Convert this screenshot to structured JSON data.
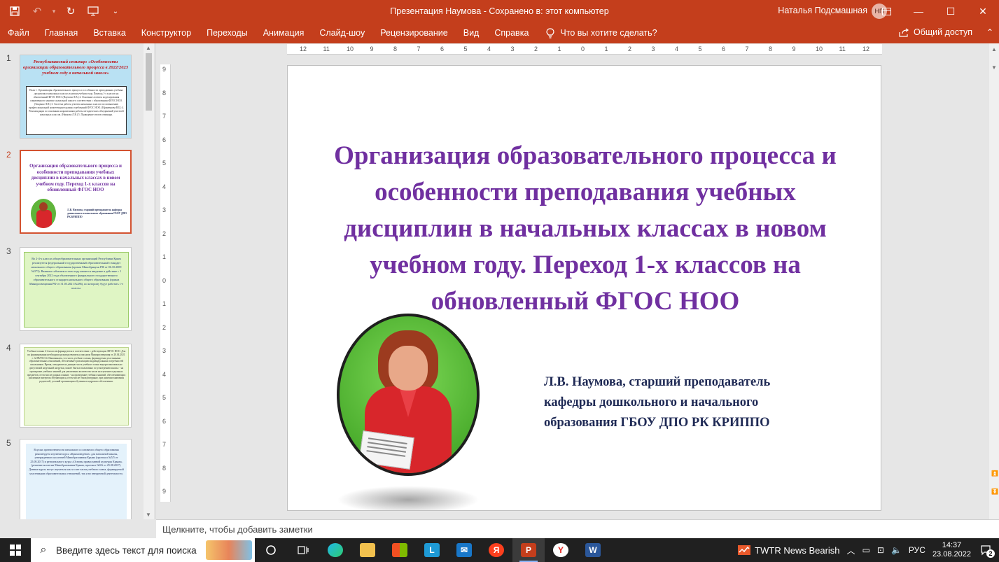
{
  "app": {
    "window_title": "Презентация Наумова  -  Сохранено в: этот компьютер",
    "user_name": "Наталья Подсмашная",
    "user_initials": "НП"
  },
  "ribbon": {
    "tabs": [
      "Файл",
      "Главная",
      "Вставка",
      "Конструктор",
      "Переходы",
      "Анимация",
      "Слайд-шоу",
      "Рецензирование",
      "Вид",
      "Справка"
    ],
    "tell_me": "Что вы хотите сделать?",
    "share": "Общий доступ"
  },
  "thumbnails": {
    "numbers": [
      "1",
      "2",
      "3",
      "4",
      "5"
    ],
    "s1": {
      "title": "Республиканский семинар: «Особенности организации образовательного процесса в 2022/2023 учебном году в начальной школе»",
      "body": "План 1. Организация образовательного процесса и особенности преподавания учебных дисциплин в начальных классах в новом учебном году. Переход 1-х классов на обновленный ФГОС НОО. (Наумова Л.В.) 2. Основные аспекты моделирования современного занятия в начальной школе в соответствии с обновленным ФГОС НОО. (Тищенко Л.Н.) 3. Система работы учителя начальных классов по повышению профессиональной компетенции в рамках требований ФГОС НОО. (Ефименкова В.Б.) 4. Рекомендации по основным направлениям работы методических объединений учителей начальных классов. (Наумова Л.В.) 5. Подведение итогов семинара."
    },
    "s2": {
      "title": "Организация образовательного процесса и особенности преподавания учебных дисциплин в начальных классах в новом учебном году. Переход 1-х классов на обновленный ФГОС НОО",
      "caption": "Л.В. Наумова, старший преподаватель кафедры дошкольного и начального образования ГБОУ ДПО РК КРИППО"
    },
    "s3": {
      "body": "Во 2-4-х классах общеобразовательных организаций Республики Крым реализуется федеральный государственный образовательный стандарт начального общего образования (приказ Минобрнауки РФ от 06.10.2009 №373). Важным событием в этом году является введение в действие с 1 сентября 2022 года обновленного федерального государственного образовательного стандарта начального общего образования (приказ Минпросвещения РФ от 31.05.2021 №286), по которому будут работать 1-е классы."
    },
    "s4": {
      "body": "Учебные планы 2-4 классов формируются в соответствии с действующим ФГОС НОО. Для их формирования необходимо руководствоваться письмом Минпросвещения от 20.04.2021 г. №ТВ/591/14. Напоминаем, что часть учебного плана, формируемая участниками образовательных отношений, обеспечивает реализацию индивидуальных потребностей школьников. Время, отводимое на данную часть учебного плана внутри максимально допустимой недельной нагрузки, может быть использовано по усмотрению школы: - на проведение учебных занятий для увеличения количества часов на изучение отдельных предметов, в том числе родных языков; - на проведение учебных занятий, обеспечивающих различные интересы обучающихся, в том числе этнокультурные, при наличии заявления родителей, условий организации обучения и кадрового обеспечения."
    },
    "s5": {
      "body": "В целях преемственности начального и основного общего образования рекомендуем изучение курса «Крымоведение» для начальной школы, утвержденного коллегией Минобразования Крыма (протокол №5/5 от 25.08.2017) и регионального курса «Основы православной культуры Крыма» (решение коллегии Минобразования Крыма, протокол №5/6 от 25.08.2017). Данные курсы могут изучаться как за счет части учебного плана, формируемой участниками образовательных отношений, так и во внеурочной деятельности."
    }
  },
  "slide": {
    "title": "Организация образовательного процесса и особенности преподавания учебных дисциплин  в начальных классах в новом учебном году. Переход 1-х классов на обновленный ФГОС НОО",
    "author": "Л.В. Наумова, старший преподаватель кафедры дошкольного и начального образования ГБОУ ДПО РК КРИППО"
  },
  "ruler": {
    "h_ticks": [
      "12",
      "11",
      "10",
      "9",
      "8",
      "7",
      "6",
      "5",
      "4",
      "3",
      "2",
      "1",
      "0",
      "1",
      "2",
      "3",
      "4",
      "5",
      "6",
      "7",
      "8",
      "9",
      "10",
      "11",
      "12"
    ],
    "v_ticks": [
      "9",
      "8",
      "7",
      "6",
      "5",
      "4",
      "3",
      "2",
      "1",
      "0",
      "1",
      "2",
      "3",
      "4",
      "5",
      "6",
      "7",
      "8",
      "9"
    ]
  },
  "notes": {
    "placeholder": "Щелкните, чтобы добавить заметки"
  },
  "taskbar": {
    "search_placeholder": "Введите здесь текст для поиска",
    "news": "TWTR  News Bearish",
    "language": "РУС",
    "time": "14:37",
    "date": "23.08.2022",
    "notifications": "2"
  },
  "colors": {
    "accent": "#c43e1c",
    "slide_title": "#7030a0",
    "author_text": "#1f2a55"
  }
}
